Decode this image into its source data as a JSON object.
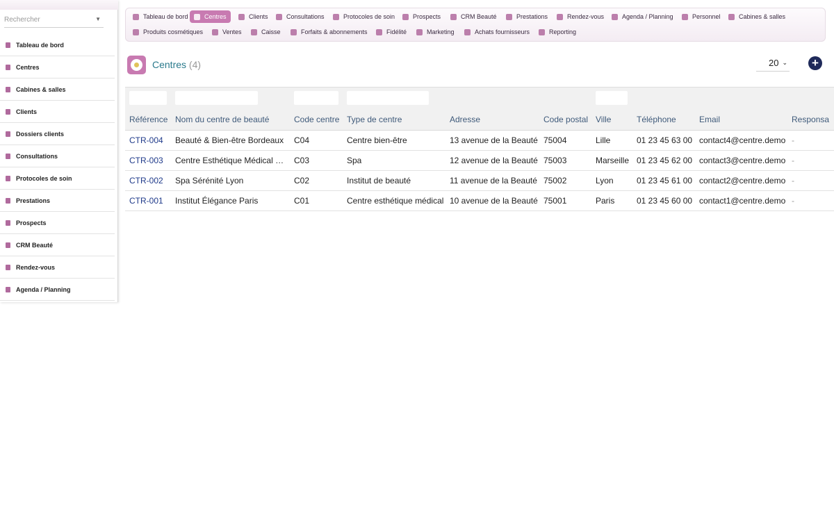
{
  "sidebar": {
    "search_placeholder": "Rechercher",
    "items": [
      {
        "label": "Tableau de bord",
        "icon": "dashboard-icon"
      },
      {
        "label": "Centres",
        "icon": "building-icon"
      },
      {
        "label": "Cabines & salles",
        "icon": "room-icon"
      },
      {
        "label": "Clients",
        "icon": "user-icon"
      },
      {
        "label": "Dossiers clients",
        "icon": "folder-icon"
      },
      {
        "label": "Consultations",
        "icon": "stethoscope-icon"
      },
      {
        "label": "Protocoles de soin",
        "icon": "document-icon"
      },
      {
        "label": "Prestations",
        "icon": "lotus-icon"
      },
      {
        "label": "Prospects",
        "icon": "user-plus-icon"
      },
      {
        "label": "CRM Beauté",
        "icon": "list-icon"
      },
      {
        "label": "Rendez-vous",
        "icon": "calendar-check-icon"
      },
      {
        "label": "Agenda / Planning",
        "icon": "calendar-icon"
      }
    ]
  },
  "topmenu": {
    "row1": [
      {
        "label": "Tableau de bord",
        "icon": "dashboard-icon"
      },
      {
        "label": "Centres",
        "icon": "building-icon",
        "active": true
      },
      {
        "label": "Clients",
        "icon": "user-icon"
      },
      {
        "label": "Consultations",
        "icon": "stethoscope-icon"
      },
      {
        "label": "Protocoles de soin",
        "icon": "document-icon"
      },
      {
        "label": "Prospects",
        "icon": "user-plus-icon"
      },
      {
        "label": "CRM Beauté",
        "icon": "list-icon"
      },
      {
        "label": "Prestations",
        "icon": "lotus-icon"
      },
      {
        "label": "Rendez-vous",
        "icon": "calendar-check-icon"
      },
      {
        "label": "Agenda / Planning",
        "icon": "calendar-icon"
      },
      {
        "label": "Personnel",
        "icon": "staff-icon"
      },
      {
        "label": "Cabines & salles",
        "icon": "room-icon"
      }
    ],
    "row2": [
      {
        "label": "Produits cosmétiques",
        "icon": "bottle-icon"
      },
      {
        "label": "Ventes",
        "icon": "basket-icon"
      },
      {
        "label": "Caisse",
        "icon": "cash-register-icon"
      },
      {
        "label": "Forfaits & abonnements",
        "icon": "card-icon"
      },
      {
        "label": "Fidélité",
        "icon": "star-icon"
      },
      {
        "label": "Marketing",
        "icon": "megaphone-icon"
      },
      {
        "label": "Achats fournisseurs",
        "icon": "cart-icon"
      },
      {
        "label": "Reporting",
        "icon": "pie-chart-icon"
      }
    ]
  },
  "page": {
    "title": "Centres",
    "count": "(4)",
    "per_page": "20"
  },
  "table": {
    "columns": [
      "Référence",
      "Nom du centre de beauté",
      "Code centre",
      "Type de centre",
      "Adresse",
      "Code postal",
      "Ville",
      "Téléphone",
      "Email",
      "Responsa"
    ],
    "rows": [
      [
        "CTR-004",
        "Beauté & Bien-être Bordeaux",
        "C04",
        "Centre bien-être",
        "13 avenue de la Beauté",
        "75004",
        "Lille",
        "01 23 45 63 00",
        "contact4@centre.demo",
        "-"
      ],
      [
        "CTR-003",
        "Centre Esthétique Médical …",
        "C03",
        "Spa",
        "12 avenue de la Beauté",
        "75003",
        "Marseille",
        "01 23 45 62 00",
        "contact3@centre.demo",
        "-"
      ],
      [
        "CTR-002",
        "Spa Sérénité Lyon",
        "C02",
        "Institut de beauté",
        "11 avenue de la Beauté",
        "75002",
        "Lyon",
        "01 23 45 61 00",
        "contact2@centre.demo",
        "-"
      ],
      [
        "CTR-001",
        "Institut Élégance Paris",
        "C01",
        "Centre esthétique médical",
        "10 avenue de la Beauté",
        "75001",
        "Paris",
        "01 23 45 60 00",
        "contact1@centre.demo",
        "-"
      ]
    ]
  },
  "colors": {
    "accent": "#c87ab1",
    "title": "#2a7a8c",
    "link": "#1f3a8a",
    "add_button": "#1f2a5a"
  }
}
